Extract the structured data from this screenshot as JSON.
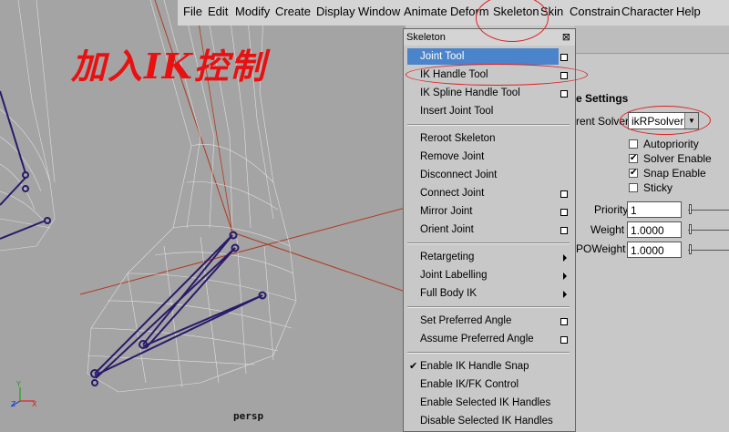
{
  "overlay_title": "加入IK控制",
  "viewport": {
    "camera_label": "persp",
    "axis_labels": [
      "Y",
      "Z",
      "X"
    ]
  },
  "menubar": [
    "File",
    "Edit",
    "Modify",
    "Create",
    "Display",
    "Window",
    "Animate",
    "Deform",
    "Skeleton",
    "Skin",
    "Constrain",
    "Character",
    "Help"
  ],
  "skeleton_menu": {
    "title": "Skeleton",
    "close": "⊠",
    "groups": [
      [
        "Joint Tool",
        "IK Handle Tool",
        "IK Spline Handle Tool",
        "Insert Joint Tool"
      ],
      [
        "Reroot Skeleton",
        "Remove Joint",
        "Disconnect Joint",
        "Connect Joint",
        "Mirror Joint",
        "Orient Joint"
      ],
      [
        "Retargeting",
        "Joint Labelling",
        "Full Body IK"
      ],
      [
        "Set Preferred Angle",
        "Assume Preferred Angle"
      ],
      [
        "Enable IK Handle Snap",
        "Enable IK/FK Control",
        "Enable Selected IK Handles",
        "Disable Selected IK Handles"
      ]
    ],
    "highlighted": "Joint Tool",
    "checked": "Enable IK Handle Snap"
  },
  "settings": {
    "section_label": "e Settings",
    "solver_label": "rent Solver",
    "solver_value": "ikRPsolver",
    "checkboxes": [
      {
        "label": "Autopriority",
        "checked": false,
        "mark": ""
      },
      {
        "label": "Solver Enable",
        "checked": true,
        "mark": "✔"
      },
      {
        "label": "Snap Enable",
        "checked": true,
        "mark": "✔"
      },
      {
        "label": "Sticky",
        "checked": false,
        "mark": ""
      }
    ],
    "priority_label": "Priority",
    "priority_value": "1",
    "weight_label": "Weight",
    "weight_value": "1.0000",
    "poweight_label": "POWeight",
    "poweight_value": "1.0000"
  },
  "colors": {
    "highlight": "#4b84ca",
    "annotation_red": "#e02020",
    "joint": "#2a1a6a"
  }
}
